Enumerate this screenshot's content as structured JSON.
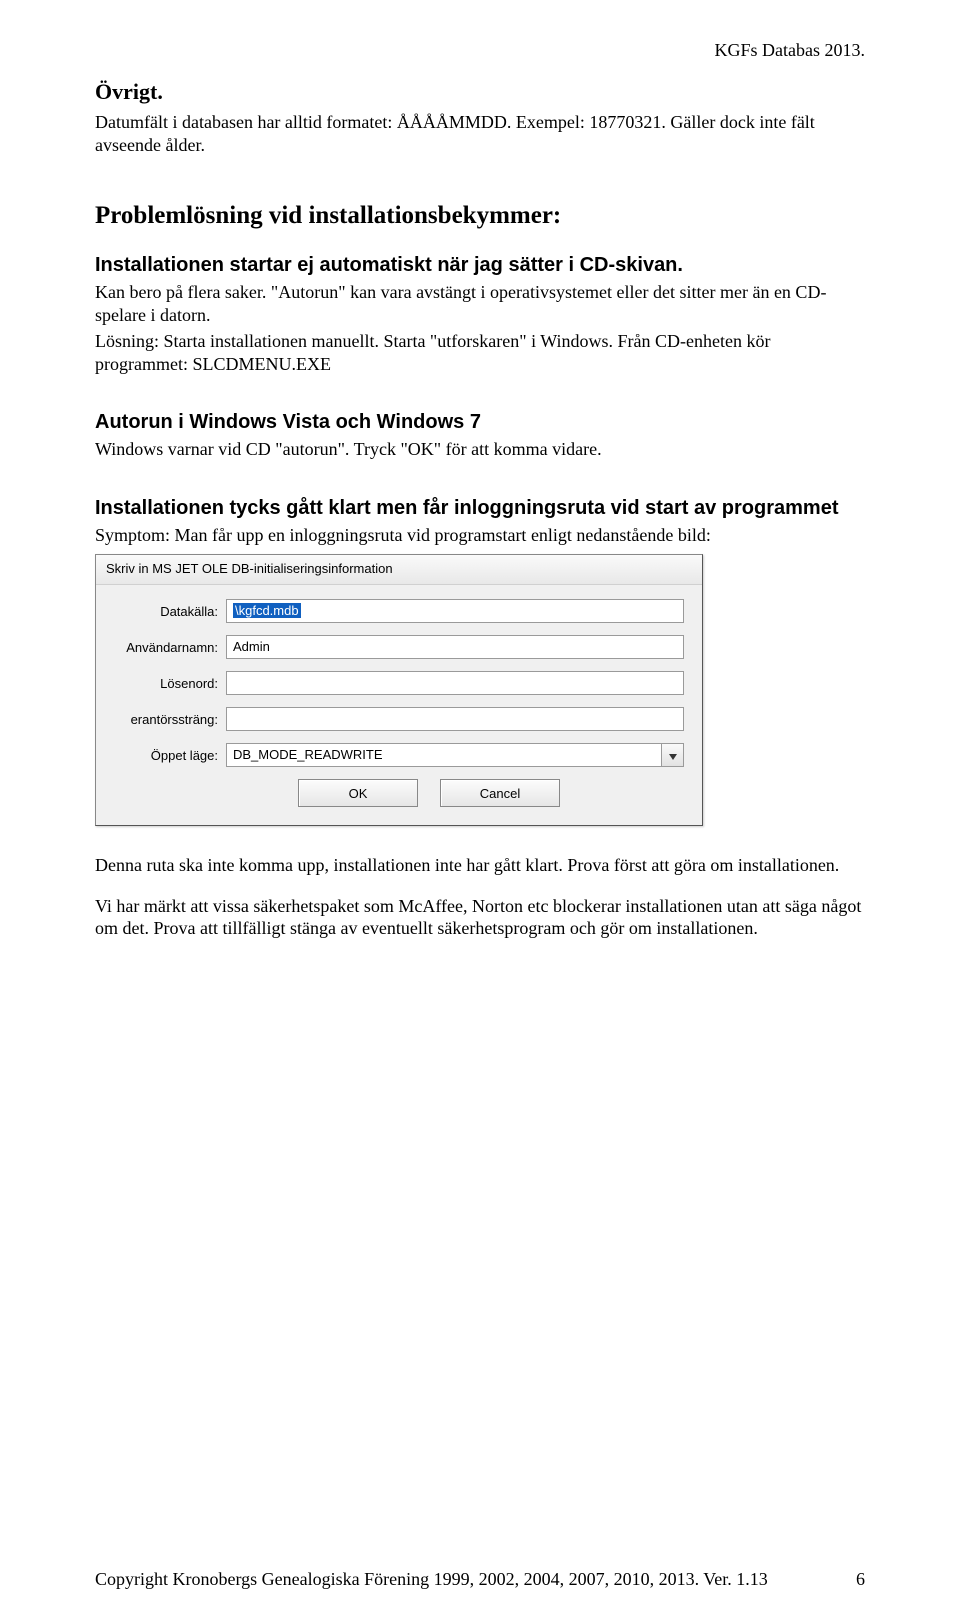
{
  "header_right": "KGFs Databas 2013.",
  "ovrigt": {
    "heading": "Övrigt.",
    "body": "Datumfält i databasen har alltid formatet: ÅÅÅÅMMDD. Exempel: 18770321. Gäller dock inte fält avseende ålder."
  },
  "problem": {
    "heading": "Problemlösning vid installationsbekymmer:",
    "sub1_heading": "Installationen startar ej automatiskt när jag sätter i CD-skivan.",
    "sub1_body1": "Kan bero på flera saker. \"Autorun\" kan vara avstängt i operativsystemet eller det sitter mer än en CD-spelare i datorn.",
    "sub1_body2": "Lösning: Starta installationen manuellt. Starta \"utforskaren\" i Windows. Från CD-enheten kör programmet: SLCDMENU.EXE",
    "autorun_heading": "Autorun i Windows Vista och Windows 7",
    "autorun_body": "Windows varnar vid CD \"autorun\". Tryck \"OK\" för att komma vidare.",
    "install_heading": "Installationen tycks gått klart men får inloggningsruta vid start av programmet",
    "install_symptom": "Symptom: Man får upp en inloggningsruta vid programstart enligt nedanstående bild:"
  },
  "dialog": {
    "title": "Skriv in MS JET OLE DB-initialiseringsinformation",
    "labels": {
      "datakalla": "Datakälla:",
      "anvandarnamn": "Användarnamn:",
      "losenord": "Lösenord:",
      "erantor": "erantörssträng:",
      "oppet": "Öppet läge:"
    },
    "values": {
      "datakalla": "\\kgfcd.mdb",
      "anvandarnamn": "Admin",
      "losenord": "",
      "erantor": "",
      "oppet": "DB_MODE_READWRITE"
    },
    "buttons": {
      "ok": "OK",
      "cancel": "Cancel"
    }
  },
  "after": {
    "p1": "Denna ruta ska inte komma upp, installationen inte har gått klart. Prova först att göra om installationen.",
    "p2": "Vi har märkt att vissa säkerhetspaket som McAffee, Norton etc blockerar installationen utan att säga något om det. Prova att tillfälligt stänga av eventuellt säkerhetsprogram och gör om installationen."
  },
  "footer": {
    "left": "Copyright Kronobergs Genealogiska Förening 1999, 2002, 2004, 2007, 2010, 2013.  Ver. 1.13",
    "right": "6"
  }
}
